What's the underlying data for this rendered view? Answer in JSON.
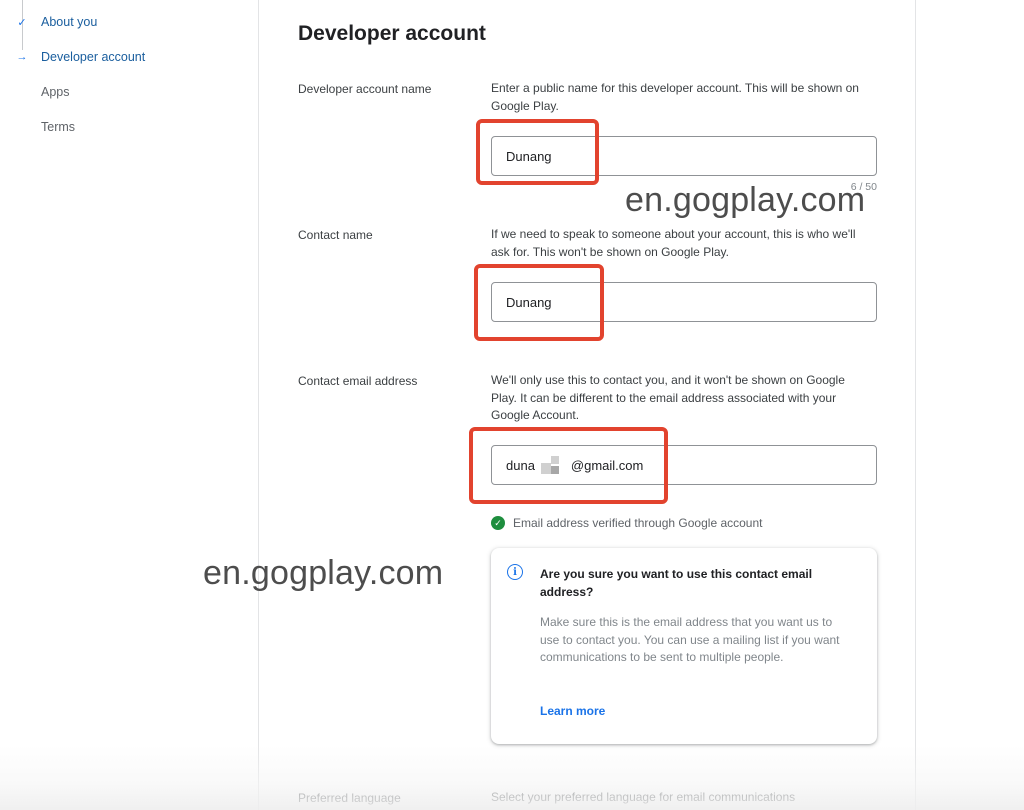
{
  "stepper": {
    "steps": [
      {
        "label": "About you",
        "state": "done",
        "icon": "check-icon"
      },
      {
        "label": "Developer account",
        "state": "current",
        "icon": "arrow-right-icon"
      },
      {
        "label": "Apps",
        "state": "todo"
      },
      {
        "label": "Terms",
        "state": "todo"
      }
    ]
  },
  "main": {
    "title": "Developer account",
    "developer_name": {
      "label": "Developer account name",
      "help": "Enter a public name for this developer account. This will be shown on Google Play.",
      "value": "Dunang",
      "counter": "6 / 50"
    },
    "contact_name": {
      "label": "Contact name",
      "help": "If we need to speak to someone about your account, this is who we'll ask for. This won't be shown on Google Play.",
      "value": "Dunang"
    },
    "contact_email": {
      "label": "Contact email address",
      "help": "We'll only use this to contact you, and it won't be shown on Google Play. It can be different to the email address associated with your Google Account.",
      "value_start": "duna",
      "value_end": "@gmail.com",
      "verified": "Email address verified through Google account"
    },
    "notice": {
      "title": "Are you sure you want to use this contact email address?",
      "body": "Make sure this is the email address that you want us to use to contact you. You can use a mailing list if you want communications to be sent to multiple people.",
      "link": "Learn more"
    },
    "preferred_language": {
      "label": "Preferred language",
      "help": "Select your preferred language for email communications"
    }
  },
  "watermarks": [
    "en.gogplay.com",
    "en.gogplay.com"
  ],
  "colors": {
    "accent": "#1a73e8",
    "highlight": "#e2432e",
    "verified": "#1e8e3e"
  }
}
